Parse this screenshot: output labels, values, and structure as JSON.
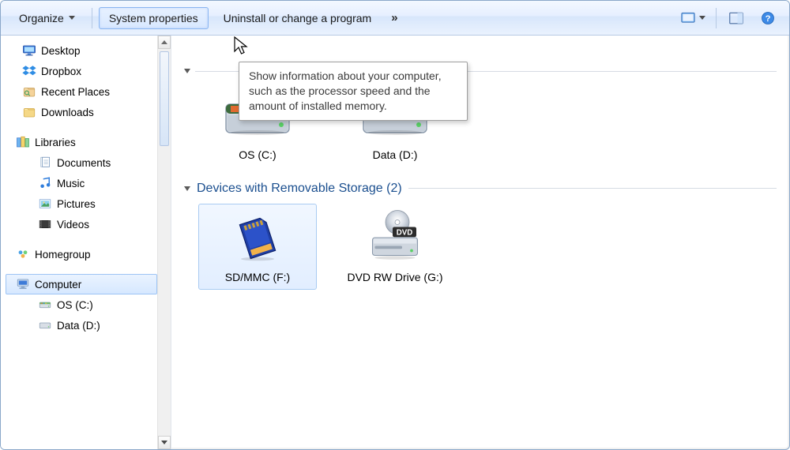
{
  "toolbar": {
    "organize": "Organize",
    "system_properties": "System properties",
    "uninstall": "Uninstall or change a program"
  },
  "tooltip": "Show information about your computer, such as the processor speed and the amount of installed memory.",
  "sidebar": {
    "favorites": [
      {
        "label": "Desktop"
      },
      {
        "label": "Dropbox"
      },
      {
        "label": "Recent Places"
      },
      {
        "label": "Downloads"
      }
    ],
    "libraries_label": "Libraries",
    "libraries": [
      {
        "label": "Documents"
      },
      {
        "label": "Music"
      },
      {
        "label": "Pictures"
      },
      {
        "label": "Videos"
      }
    ],
    "homegroup_label": "Homegroup",
    "computer_label": "Computer",
    "computer_children": [
      {
        "label": "OS (C:)"
      },
      {
        "label": "Data (D:)"
      }
    ]
  },
  "content": {
    "hard_drives": {
      "items": [
        {
          "label": "OS (C:)"
        },
        {
          "label": "Data (D:)"
        }
      ]
    },
    "removable": {
      "title": "Devices with Removable Storage (2)",
      "items": [
        {
          "label": "SD/MMC (F:)"
        },
        {
          "label": "DVD RW Drive (G:)"
        }
      ]
    }
  }
}
